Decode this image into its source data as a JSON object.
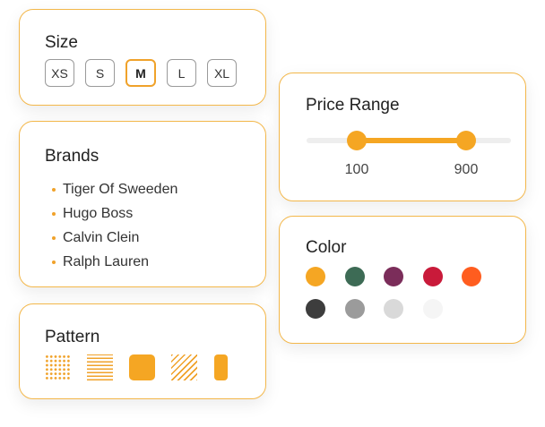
{
  "size": {
    "title": "Size",
    "options": [
      "XS",
      "S",
      "M",
      "L",
      "XL"
    ],
    "selected": "M"
  },
  "brands": {
    "title": "Brands",
    "items": [
      "Tiger Of Sweeden",
      "Hugo Boss",
      "Calvin Clein",
      "Ralph Lauren"
    ]
  },
  "pattern": {
    "title": "Pattern",
    "swatches": [
      "dots",
      "horizontal-lines",
      "solid",
      "diagonal-lines",
      "solid-narrow"
    ]
  },
  "price": {
    "title": "Price Range",
    "min_value": "100",
    "max_value": "900"
  },
  "color": {
    "title": "Color",
    "swatches": [
      "#f5a623",
      "#3d6b55",
      "#7b2d5a",
      "#c91a3a",
      "#ff5d1f",
      "#3d3d3d",
      "#9b9b9b",
      "#d9d9d9",
      "#f5f5f5"
    ]
  },
  "theme": {
    "accent": "#f5a623",
    "border": "#f3b74a"
  }
}
